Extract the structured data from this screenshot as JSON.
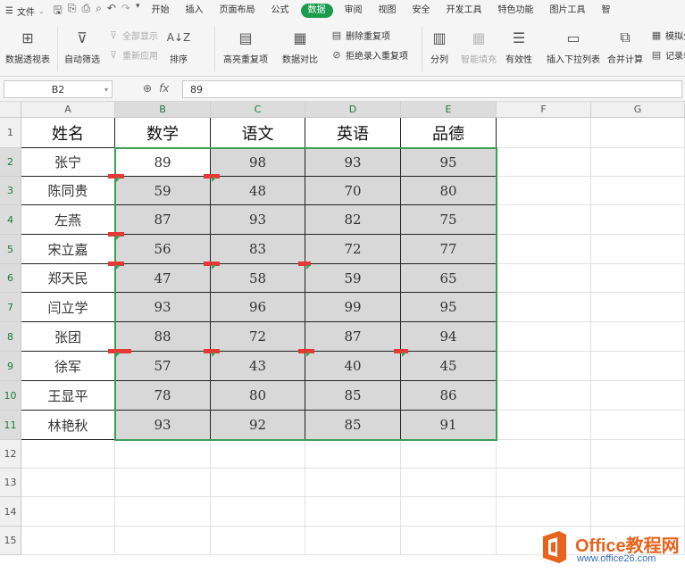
{
  "menubar": {
    "file_label": "文件",
    "tabs": [
      "开始",
      "插入",
      "页面布局",
      "公式",
      "数据",
      "审阅",
      "视图",
      "安全",
      "开发工具",
      "特色功能",
      "图片工具",
      "智"
    ],
    "active_tab": "数据"
  },
  "ribbon": {
    "pivot": "数据透视表",
    "autofilter": "自动筛选",
    "show_all": "全部显示",
    "reapply": "重新应用",
    "sort": "排序",
    "highlight_dup": "高亮重复项",
    "compare": "数据对比",
    "remove_dup": "删除重复项",
    "reject_dup": "拒绝录入重复项",
    "split": "分列",
    "smart_fill": "智能填充",
    "validity": "有效性",
    "insert_dropdown": "插入下拉列表",
    "merge_calc": "合并计算",
    "simulate": "模拟分",
    "record_list": "记录单"
  },
  "formula_bar": {
    "cell_ref": "B2",
    "value": "89"
  },
  "columns": [
    "A",
    "B",
    "C",
    "D",
    "E",
    "F",
    "G"
  ],
  "rows": [
    "1",
    "2",
    "3",
    "4",
    "5",
    "6",
    "7",
    "8",
    "9",
    "10",
    "11",
    "12",
    "13",
    "14",
    "15"
  ],
  "table": {
    "headers": [
      "姓名",
      "数学",
      "语文",
      "英语",
      "品德"
    ],
    "data": [
      [
        "张宁",
        "89",
        "98",
        "93",
        "95"
      ],
      [
        "陈同贵",
        "59",
        "48",
        "70",
        "80"
      ],
      [
        "左燕",
        "87",
        "93",
        "82",
        "75"
      ],
      [
        "宋立嘉",
        "56",
        "83",
        "72",
        "77"
      ],
      [
        "郑天民",
        "47",
        "58",
        "59",
        "65"
      ],
      [
        "闫立学",
        "93",
        "96",
        "99",
        "95"
      ],
      [
        "张团",
        "88",
        "72",
        "87",
        "94"
      ],
      [
        "徐军",
        "57",
        "43",
        "40",
        "45"
      ],
      [
        "王显平",
        "78",
        "80",
        "85",
        "86"
      ],
      [
        "林艳秋",
        "93",
        "92",
        "85",
        "91"
      ]
    ]
  },
  "watermark": {
    "title": "Office教程网",
    "url": "www.office26.com"
  },
  "colors": {
    "accent_green": "#1c9b4f",
    "selection_border": "#3c9f56",
    "marker_red": "#e53935",
    "watermark_orange": "#e8641e"
  }
}
